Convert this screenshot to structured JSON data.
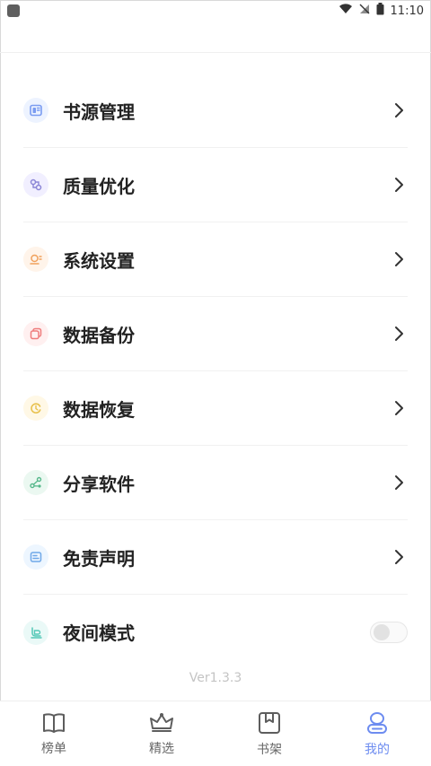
{
  "status_bar": {
    "time": "11:10",
    "icons": [
      "wifi-icon",
      "signal-off-icon",
      "battery-icon"
    ]
  },
  "menu": {
    "items": [
      {
        "label": "书源管理",
        "icon": "book-source-icon",
        "icon_color": "#7a9cf1",
        "icon_bg": "#edf3ff",
        "action": "chevron-right-icon"
      },
      {
        "label": "质量优化",
        "icon": "quality-optimize-icon",
        "icon_color": "#8b86d6",
        "icon_bg": "#f1efff",
        "action": "chevron-right-icon"
      },
      {
        "label": "系统设置",
        "icon": "system-settings-icon",
        "icon_color": "#f0a15d",
        "icon_bg": "#fff4ea",
        "action": "chevron-right-icon"
      },
      {
        "label": "数据备份",
        "icon": "backup-icon",
        "icon_color": "#ef7c7c",
        "icon_bg": "#fff0f0",
        "action": "chevron-right-icon"
      },
      {
        "label": "数据恢复",
        "icon": "restore-icon",
        "icon_color": "#e8c04a",
        "icon_bg": "#fff8e6",
        "action": "chevron-right-icon"
      },
      {
        "label": "分享软件",
        "icon": "share-icon",
        "icon_color": "#56b88b",
        "icon_bg": "#ebf8f1",
        "action": "chevron-right-icon"
      },
      {
        "label": "免责声明",
        "icon": "disclaimer-icon",
        "icon_color": "#6fa8e8",
        "icon_bg": "#edf6ff",
        "action": "chevron-right-icon"
      },
      {
        "label": "夜间模式",
        "icon": "night-mode-icon",
        "icon_color": "#53c7b6",
        "icon_bg": "#eaf9f7",
        "action": "toggle",
        "toggle_on": false
      }
    ]
  },
  "version": "Ver1.3.3",
  "tabbar": {
    "tabs": [
      {
        "label": "榜单",
        "icon": "rank-book-icon",
        "active": false
      },
      {
        "label": "精选",
        "icon": "crown-icon",
        "active": false
      },
      {
        "label": "书架",
        "icon": "bookshelf-icon",
        "active": false
      },
      {
        "label": "我的",
        "icon": "profile-icon",
        "active": true
      }
    ],
    "active_color": "#6d8cf0"
  }
}
